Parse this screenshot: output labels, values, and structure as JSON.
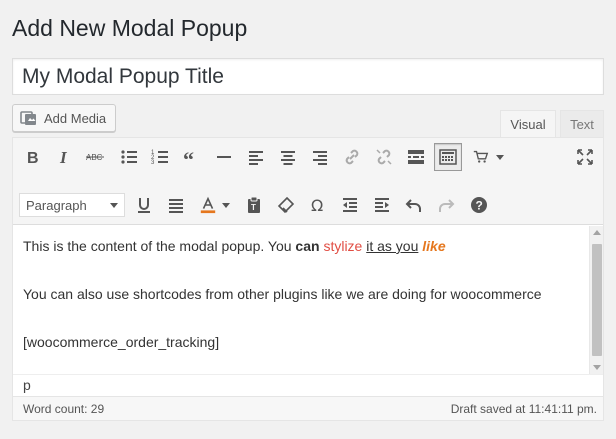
{
  "page": {
    "title": "Add New Modal Popup"
  },
  "title_input": {
    "value": "My Modal Popup Title"
  },
  "media": {
    "add_media_label": "Add Media"
  },
  "tabs": {
    "visual": "Visual",
    "text": "Text"
  },
  "toolbar": {
    "row1": [
      "bold-icon",
      "italic-icon",
      "strikethrough-icon",
      "bullet-list-icon",
      "numbered-list-icon",
      "blockquote-icon",
      "horizontal-rule-icon",
      "align-left-icon",
      "align-center-icon",
      "align-right-icon",
      "link-icon",
      "unlink-icon",
      "read-more-icon",
      "toolbar-toggle-icon",
      "cart-icon",
      "fullscreen-icon"
    ],
    "format_select_value": "Paragraph"
  },
  "content": {
    "line1": {
      "plain": "This is the content of the modal popup. You ",
      "bold": "can",
      "red": "stylize",
      "underlined": "it as you",
      "italic": "like"
    },
    "line2": "You can also use shortcodes from other plugins like we are doing for woocommerce",
    "line3": "[woocommerce_order_tracking]"
  },
  "path": "p",
  "status": {
    "word_count": "Word count: 29",
    "draft_saved": "Draft saved at 11:41:11 pm."
  },
  "colors": {
    "accent_red": "#e14d43",
    "accent_orange": "#e5771e",
    "toolbar_bg": "#f5f5f5"
  }
}
